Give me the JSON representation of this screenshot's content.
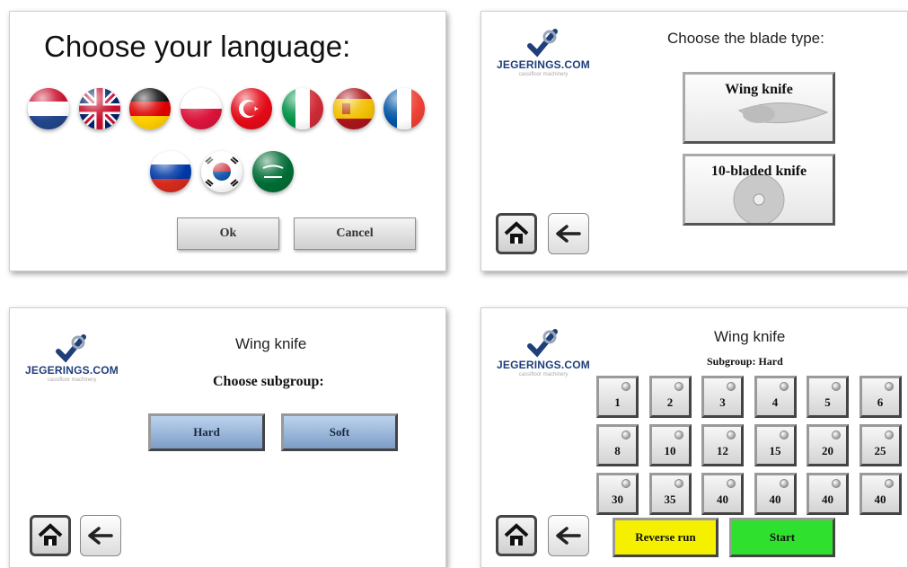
{
  "language_panel": {
    "title": "Choose your language:",
    "flags": [
      "netherlands-flag",
      "uk-flag",
      "germany-flag",
      "poland-flag",
      "turkey-flag",
      "italy-flag",
      "spain-flag",
      "france-flag",
      "russia-flag",
      "south-korea-flag",
      "saudi-arabia-flag"
    ],
    "ok_label": "Ok",
    "cancel_label": "Cancel"
  },
  "logo": {
    "brand": "JEGERINGS.COM",
    "tagline": "cassifloor machinery"
  },
  "blade_panel": {
    "title": "Choose the blade type:",
    "options": [
      "Wing knife",
      "10-bladed knife"
    ]
  },
  "subgroup_panel": {
    "title": "Wing knife",
    "heading": "Choose subgroup:",
    "options": [
      "Hard",
      "Soft"
    ]
  },
  "settings_panel": {
    "title": "Wing knife",
    "subtitle": "Subgroup: Hard",
    "values": [
      "1",
      "2",
      "3",
      "4",
      "5",
      "6",
      "8",
      "10",
      "12",
      "15",
      "20",
      "25",
      "30",
      "35",
      "40",
      "40",
      "40",
      "40"
    ],
    "reverse_label": "Reverse run",
    "start_label": "Start",
    "colors": {
      "reverse": "#f4f000",
      "start": "#2fe02f"
    }
  },
  "nav": {
    "home_icon": "home-icon",
    "back_icon": "back-arrow-icon"
  }
}
